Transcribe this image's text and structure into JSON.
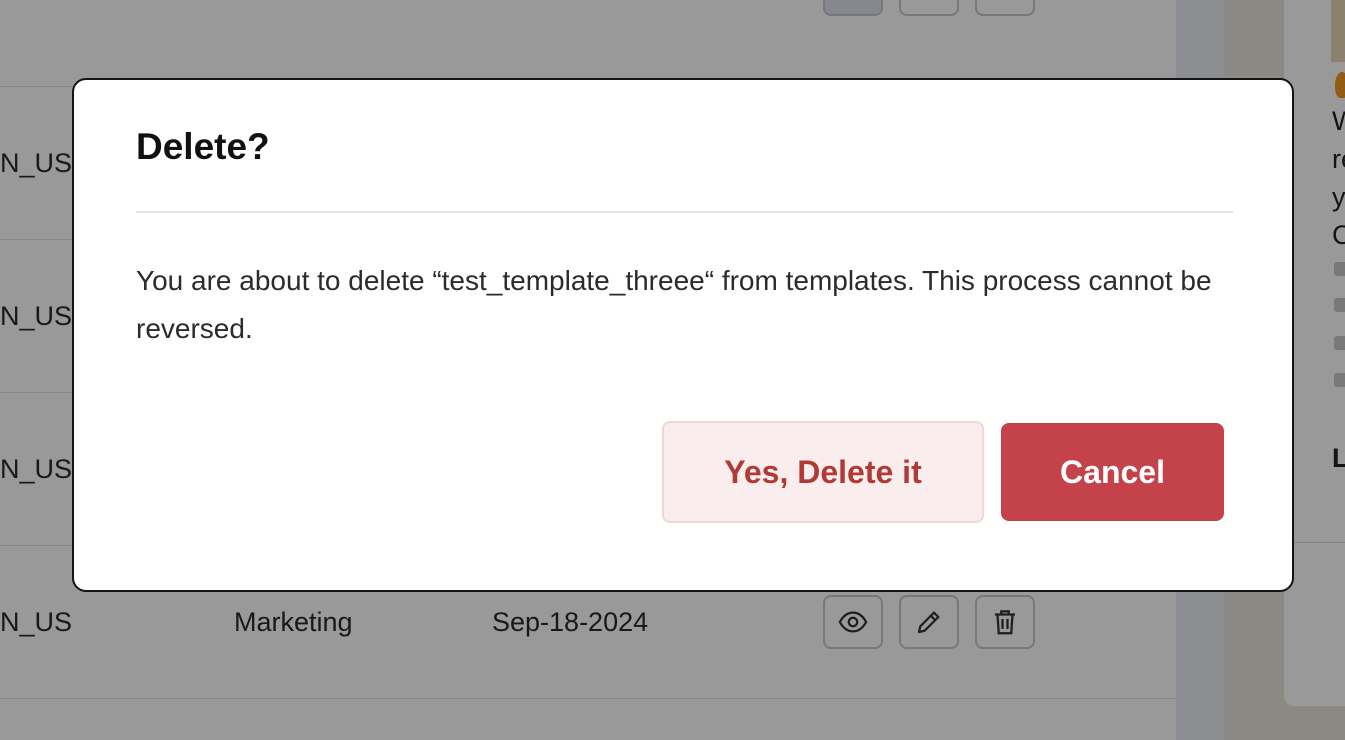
{
  "table": {
    "rows": [
      {
        "language": "N_US"
      },
      {
        "language": "N_US"
      },
      {
        "language": "N_US"
      },
      {
        "language": "N_US",
        "category": "Marketing",
        "date": "Sep-18-2024"
      }
    ],
    "actions": {
      "view_icon": "eye-icon",
      "edit_icon": "pencil-icon",
      "delete_icon": "trash-icon"
    }
  },
  "side_chat": {
    "visible_letters": [
      "W",
      "re",
      "y",
      "C",
      "L"
    ]
  },
  "dialog": {
    "title": "Delete?",
    "message": "You are about to delete “test_template_threee“ from templates. This process cannot be reversed.",
    "confirm_label": "Yes, Delete it",
    "cancel_label": "Cancel"
  },
  "colors": {
    "danger": "#c4434b",
    "danger_soft_bg": "#faeded",
    "danger_text": "#b03a36",
    "overlay": "rgba(0,0,0,0.4)"
  }
}
